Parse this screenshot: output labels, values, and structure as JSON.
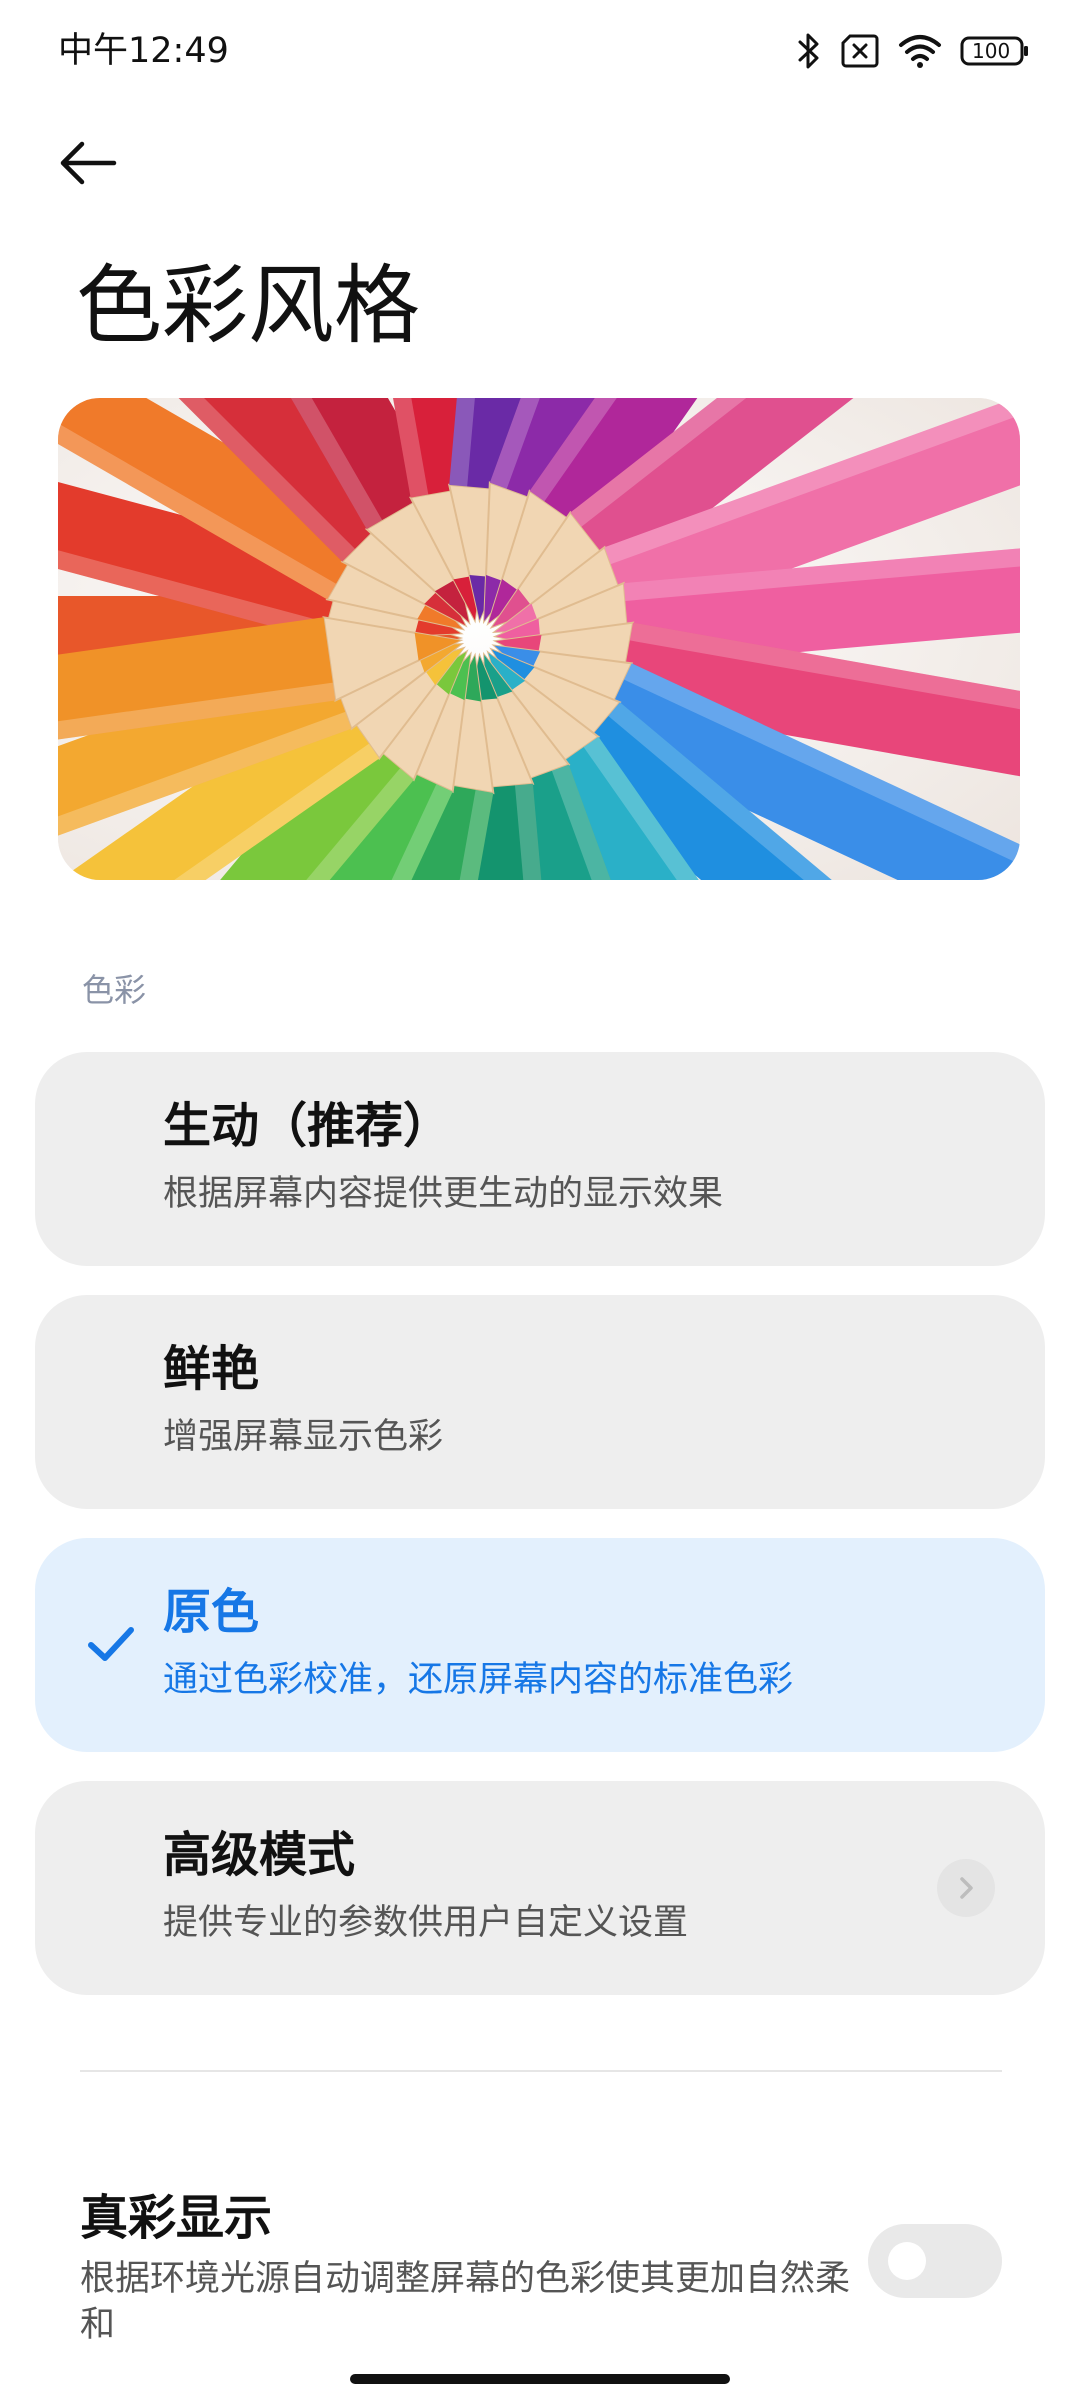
{
  "status_bar": {
    "time": "中午12:49",
    "battery": "100",
    "icons": [
      "bluetooth-icon",
      "no-sim-icon",
      "wifi-icon",
      "battery-icon"
    ]
  },
  "header": {
    "back_icon": "arrow-left-icon",
    "title": "色彩风格"
  },
  "hero": {
    "description": "colored-pencils-image"
  },
  "section": {
    "label": "色彩"
  },
  "options": [
    {
      "title": "生动（推荐）",
      "description": "根据屏幕内容提供更生动的显示效果",
      "selected": false
    },
    {
      "title": "鲜艳",
      "description": "增强屏幕显示色彩",
      "selected": false
    },
    {
      "title": "原色",
      "description": "通过色彩校准，还原屏幕内容的标准色彩",
      "selected": true
    },
    {
      "title": "高级模式",
      "description": "提供专业的参数供用户自定义设置",
      "selected": false,
      "has_chevron": true
    }
  ],
  "true_color": {
    "title": "真彩显示",
    "description": "根据环境光源自动调整屏幕的色彩使其更加自然柔和",
    "enabled": false
  },
  "colors": {
    "accent": "#1677e6",
    "selected_bg": "#e3f0fd",
    "card_bg": "#eeeeee",
    "section_label": "#8a93a7"
  }
}
